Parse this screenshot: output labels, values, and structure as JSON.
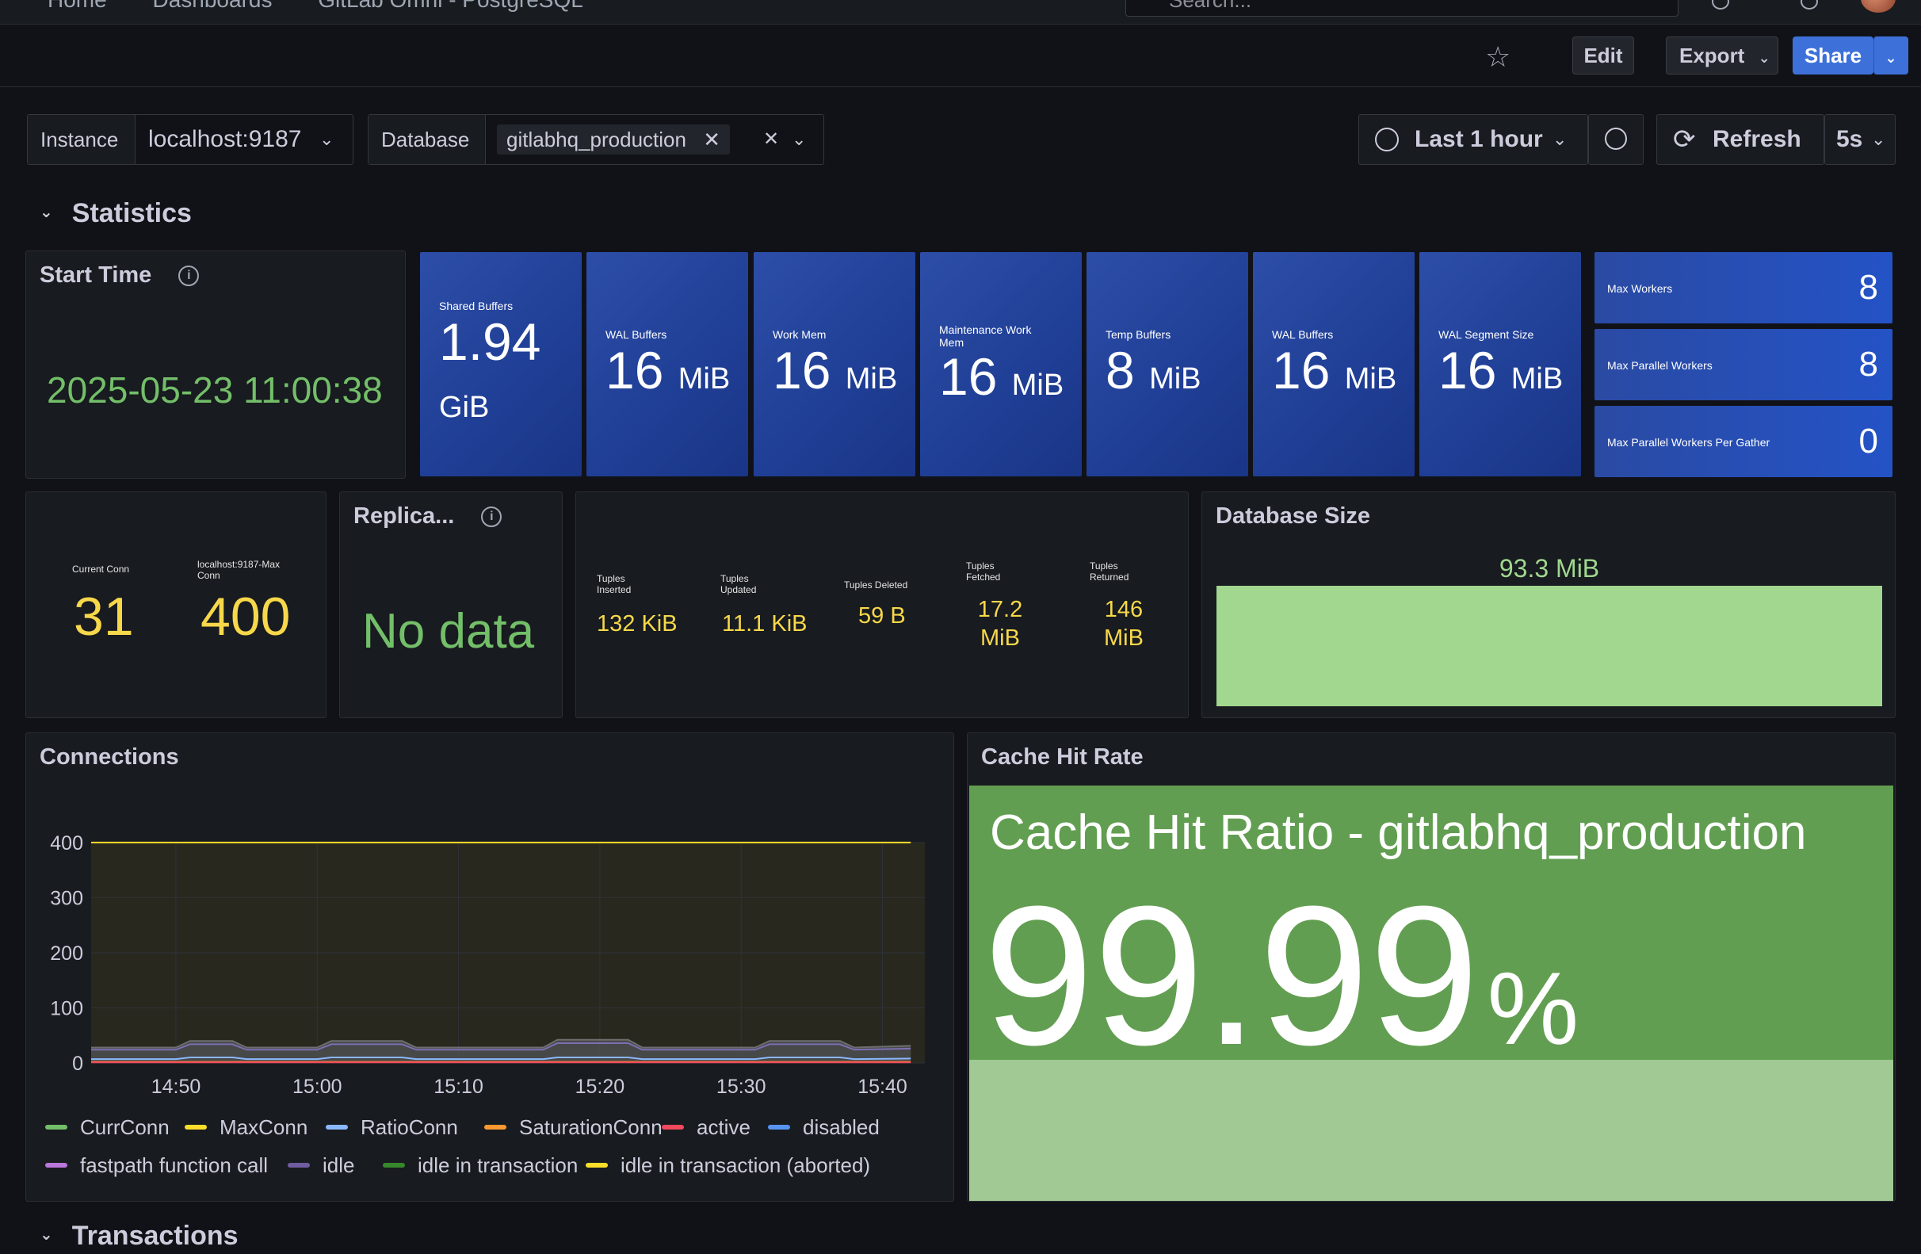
{
  "topnav": {
    "crumbs": [
      "Home",
      "Dashboards",
      "GitLab Omni - PostgreSQL"
    ],
    "search_placeholder": "Search..."
  },
  "toolbar": {
    "edit_label": "Edit",
    "export_label": "Export",
    "share_label": "Share"
  },
  "variables": {
    "instance_label": "Instance",
    "instance_value": "localhost:9187",
    "database_label": "Database",
    "database_value": "gitlabhq_production",
    "time_range": "Last 1 hour",
    "refresh_label": "Refresh",
    "refresh_interval": "5s"
  },
  "rows": {
    "statistics": "Statistics",
    "transactions": "Transactions"
  },
  "start_time": {
    "title": "Start Time",
    "value": "2025-05-23 11:00:38",
    "color": "#73bf69"
  },
  "settings_tiles": [
    {
      "label": "Shared Buffers",
      "value": "1.94",
      "unit": "GiB"
    },
    {
      "label": "WAL Buffers",
      "value": "16",
      "unit": "MiB"
    },
    {
      "label": "Work Mem",
      "value": "16",
      "unit": "MiB"
    },
    {
      "label": "Maintenance Work Mem",
      "value": "16",
      "unit": "MiB"
    },
    {
      "label": "Temp Buffers",
      "value": "8",
      "unit": "MiB"
    },
    {
      "label": "WAL Buffers",
      "value": "16",
      "unit": "MiB"
    },
    {
      "label": "WAL Segment Size",
      "value": "16",
      "unit": "MiB"
    }
  ],
  "workers": [
    {
      "label": "Max Workers",
      "value": "8"
    },
    {
      "label": "Max Parallel Workers",
      "value": "8"
    },
    {
      "label": "Max Parallel Workers Per Gather",
      "value": "0"
    }
  ],
  "connections_stat": {
    "current_label": "Current Conn",
    "current_value": "31",
    "max_label": "localhost:9187-Max Conn",
    "max_value": "400"
  },
  "replication": {
    "title": "Replica...",
    "value": "No data"
  },
  "tuples": [
    {
      "label": "Tuples Inserted",
      "value": "132 KiB"
    },
    {
      "label": "Tuples Updated",
      "value": "11.1 KiB"
    },
    {
      "label": "Tuples Deleted",
      "value": "59 B"
    },
    {
      "label": "Tuples Fetched",
      "value": "17.2 MiB"
    },
    {
      "label": "Tuples Returned",
      "value": "146 MiB"
    }
  ],
  "database_size": {
    "title": "Database Size",
    "value": "93.3 MiB",
    "fill_fraction": 1.0,
    "color": "#a1d78f"
  },
  "cache_hit": {
    "title": "Cache Hit Rate",
    "heading": "Cache Hit Ratio - gitlabhq_production",
    "value": "99.99",
    "unit": "%",
    "fill_fraction": 0.9999,
    "color": "#629e51"
  },
  "connections_chart": {
    "title": "Connections",
    "legend": [
      {
        "name": "CurrConn",
        "color": "#73bf69"
      },
      {
        "name": "MaxConn",
        "color": "#fade2a"
      },
      {
        "name": "RatioConn",
        "color": "#8ab8ff"
      },
      {
        "name": "SaturationConn",
        "color": "#ff9830"
      },
      {
        "name": "active",
        "color": "#f2495c"
      },
      {
        "name": "disabled",
        "color": "#5794f2"
      },
      {
        "name": "fastpath function call",
        "color": "#b877d9"
      },
      {
        "name": "idle",
        "color": "#705da0"
      },
      {
        "name": "idle in transaction",
        "color": "#37872d"
      },
      {
        "name": "idle in transaction (aborted)",
        "color": "#fade2a"
      }
    ]
  },
  "chart_data": {
    "type": "line",
    "title": "Connections",
    "xlabel": "",
    "ylabel": "",
    "x_ticks": [
      "14:50",
      "15:00",
      "15:10",
      "15:20",
      "15:30",
      "15:40"
    ],
    "y_ticks": [
      0,
      100,
      200,
      300,
      400
    ],
    "ylim": [
      0,
      420
    ],
    "grid": true,
    "legend_position": "bottom",
    "x": [
      "14:44",
      "14:50",
      "14:51",
      "14:54",
      "14:55",
      "15:00",
      "15:01",
      "15:06",
      "15:07",
      "15:16",
      "15:17",
      "15:22",
      "15:23",
      "15:31",
      "15:32",
      "15:37",
      "15:38",
      "15:42"
    ],
    "series": [
      {
        "name": "MaxConn",
        "values": [
          400,
          400,
          400,
          400,
          400,
          400,
          400,
          400,
          400,
          400,
          400,
          400,
          400,
          400,
          400,
          400,
          400,
          400
        ]
      },
      {
        "name": "CurrConn",
        "values": [
          28,
          28,
          40,
          40,
          28,
          28,
          40,
          40,
          28,
          28,
          42,
          42,
          28,
          28,
          40,
          40,
          28,
          31
        ]
      },
      {
        "name": "idle",
        "values": [
          24,
          24,
          34,
          34,
          24,
          24,
          34,
          34,
          24,
          24,
          36,
          36,
          24,
          24,
          34,
          34,
          24,
          26
        ]
      },
      {
        "name": "RatioConn",
        "values": [
          7,
          7,
          10,
          10,
          7,
          7,
          10,
          10,
          7,
          7,
          10,
          10,
          7,
          7,
          10,
          10,
          7,
          8
        ]
      },
      {
        "name": "SaturationConn",
        "values": [
          2,
          2,
          2,
          2,
          2,
          2,
          2,
          2,
          2,
          2,
          2,
          2,
          2,
          2,
          2,
          2,
          2,
          2
        ]
      },
      {
        "name": "active",
        "values": [
          1,
          1,
          1,
          1,
          1,
          1,
          1,
          1,
          1,
          1,
          1,
          1,
          1,
          1,
          1,
          1,
          1,
          1
        ]
      }
    ]
  }
}
